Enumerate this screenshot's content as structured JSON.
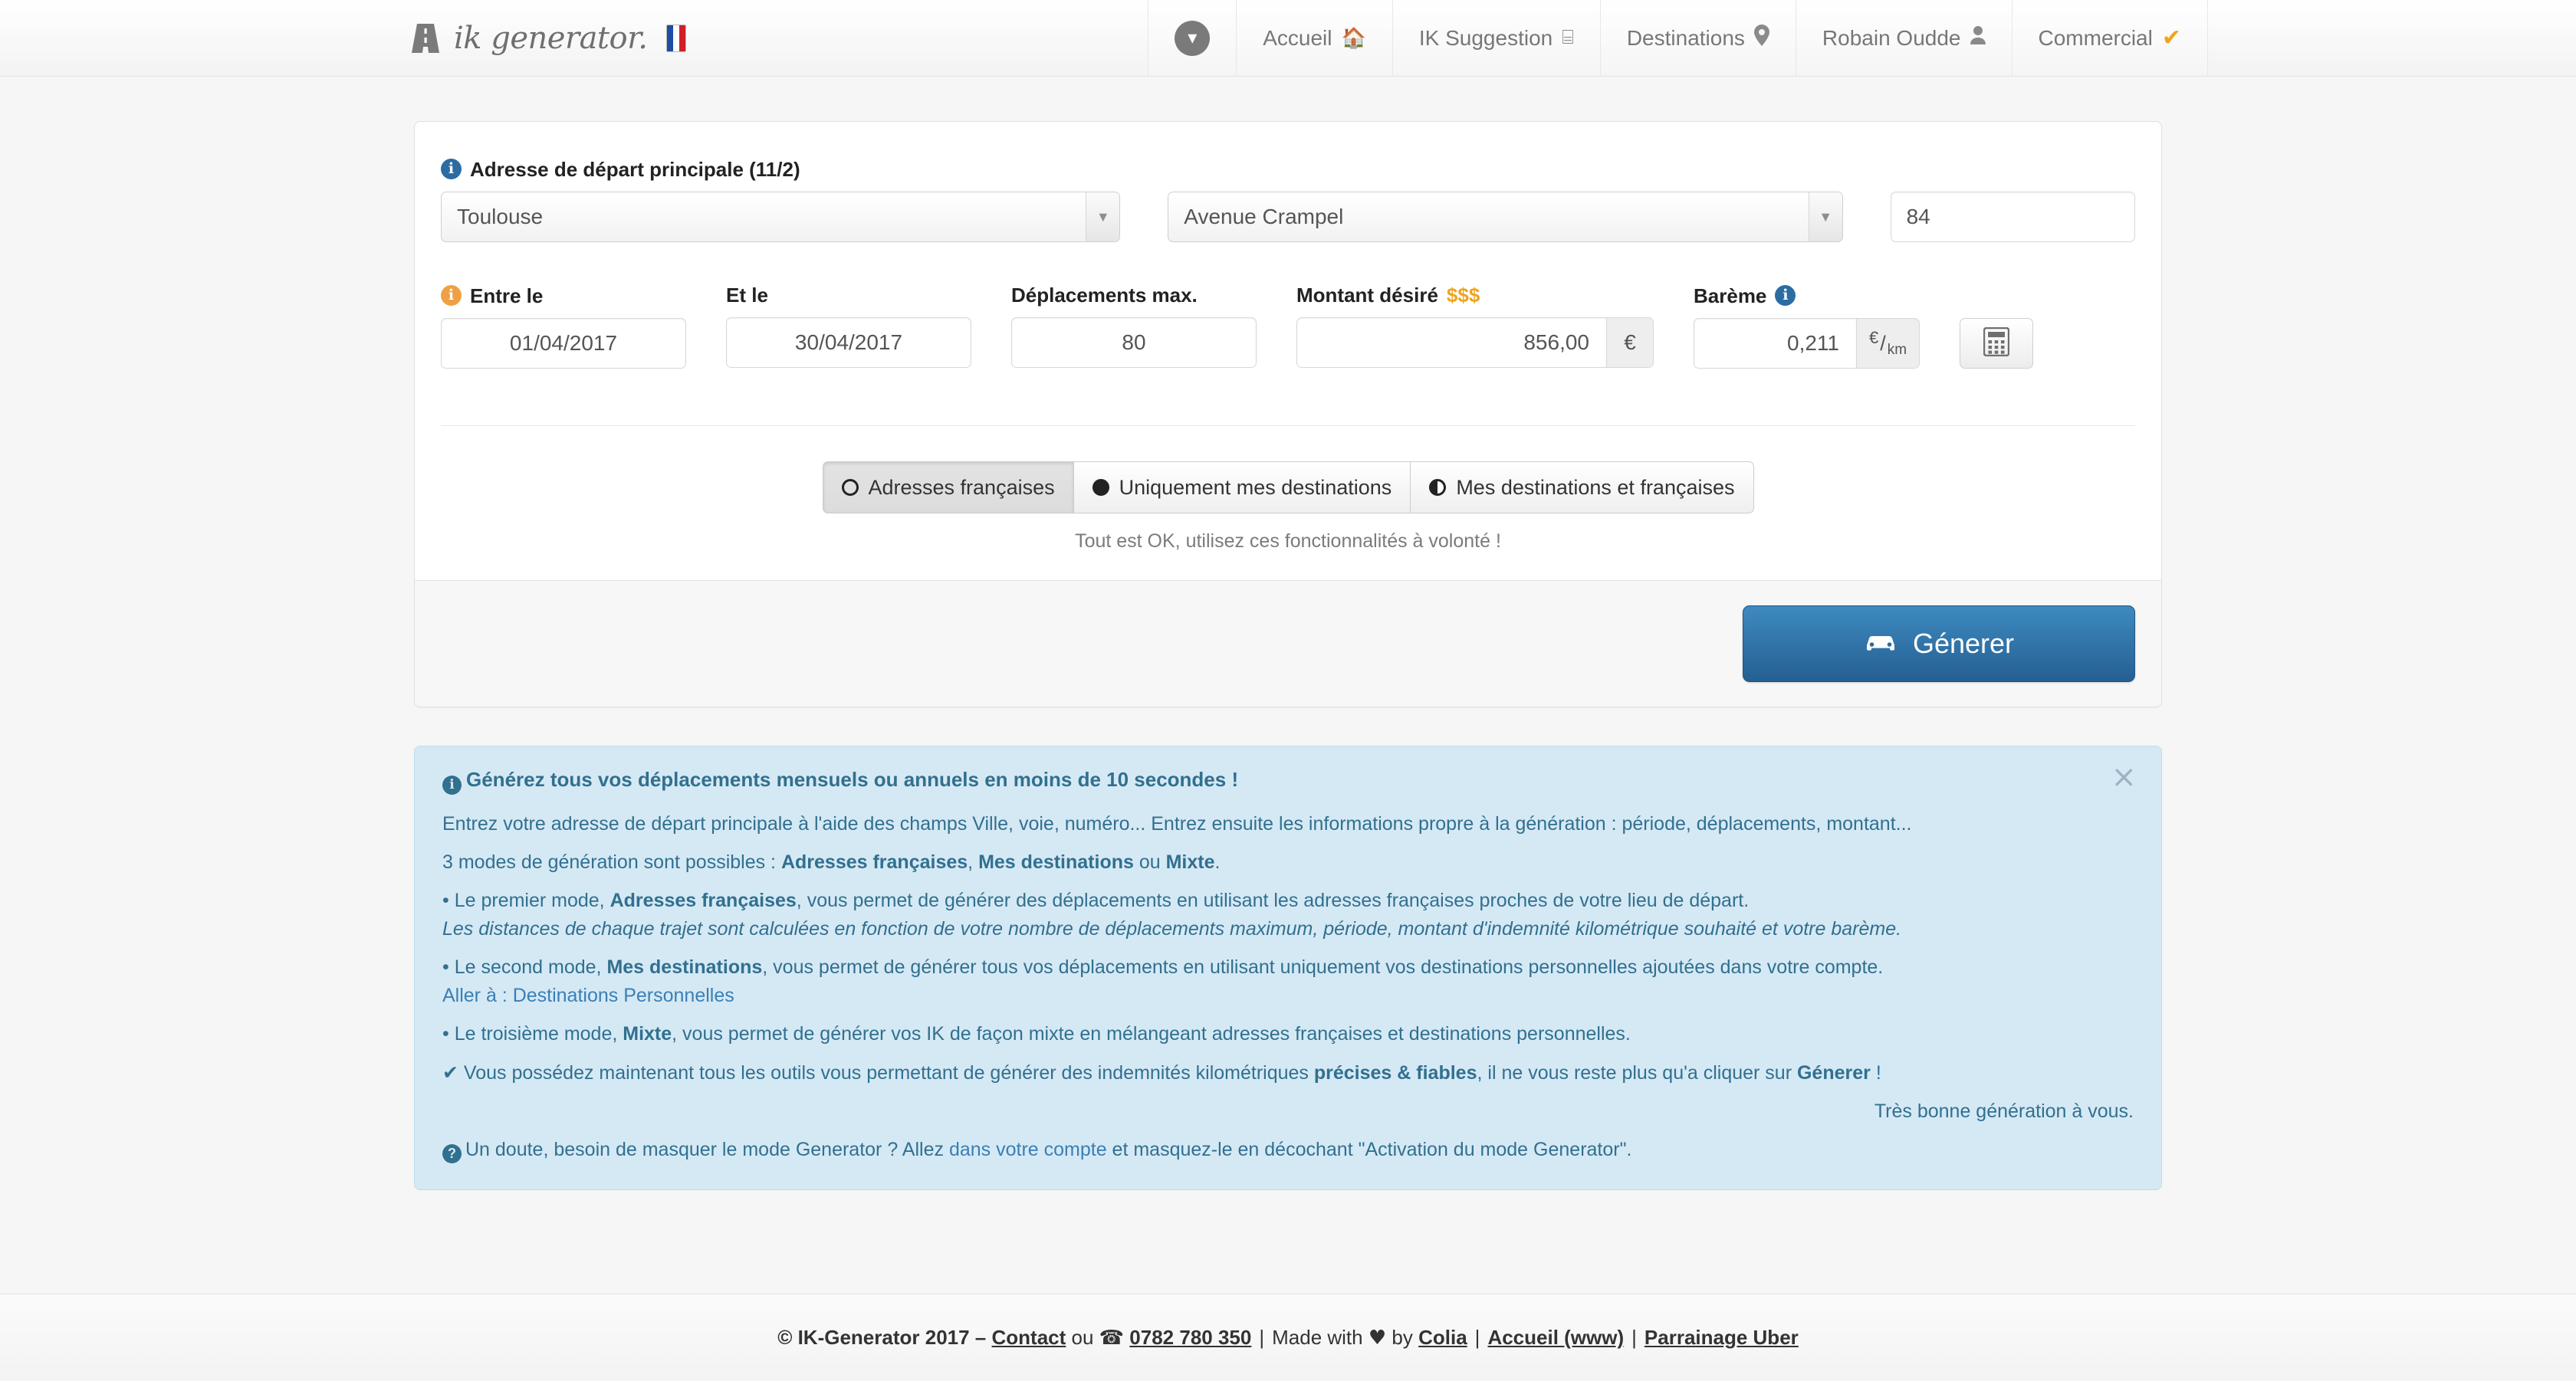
{
  "navbar": {
    "brand": {
      "text": "ik generator.",
      "flag_alt": "french-flag"
    },
    "caret_label": "▾",
    "items": [
      {
        "label": "Accueil",
        "icon": "🏠"
      },
      {
        "label": "IK Suggestion",
        "icon": "⌸"
      },
      {
        "label": "Destinations",
        "icon": "⊙"
      },
      {
        "label": "Robain Oudde",
        "icon": "☗"
      },
      {
        "label": "Commercial",
        "icon": "✔"
      }
    ]
  },
  "form": {
    "address_label": "Adresse de départ principale (11/2)",
    "city": {
      "value": "Toulouse"
    },
    "street": {
      "value": "Avenue Crampel"
    },
    "number": {
      "value": "84"
    },
    "date_from": {
      "label": "Entre le",
      "value": "01/04/2017"
    },
    "date_to": {
      "label": "Et le",
      "value": "30/04/2017"
    },
    "trips_max": {
      "label": "Déplacements max.",
      "value": "80"
    },
    "amount": {
      "label": "Montant désiré",
      "suffix_icon": "$$$",
      "value": "856,00",
      "addon": "€"
    },
    "scale": {
      "label": "Barème",
      "value": "0,211",
      "addon_num": "€",
      "addon_slash": "/",
      "addon_den": "km"
    },
    "calc_button": {
      "icon": "calculator"
    },
    "modes": [
      {
        "label": "Adresses françaises",
        "icon": "circle-empty",
        "active": true
      },
      {
        "label": "Uniquement mes destinations",
        "icon": "circle-full",
        "active": false
      },
      {
        "label": "Mes destinations et françaises",
        "icon": "circle-half",
        "active": false
      }
    ],
    "status_message": "Tout est OK, utilisez ces fonctionnalités à volonté !",
    "generate_button": "Génerer"
  },
  "alert": {
    "close": "×",
    "title": "Générez tous vos déplacements mensuels ou annuels en moins de 10 secondes !",
    "line_intro": "Entrez votre adresse de départ principale à l'aide des champs Ville, voie, numéro... Entrez ensuite les informations propre à la génération : période, déplacements, montant...",
    "modes_prefix": "3 modes de génération sont possibles : ",
    "modes_b1": "Adresses françaises",
    "modes_sep1": ", ",
    "modes_b2": "Mes destinations",
    "modes_sep2": " ou ",
    "modes_b3": "Mixte",
    "modes_suffix": ".",
    "m1_pre": "• Le premier mode, ",
    "m1_b": "Adresses françaises",
    "m1_post": ", vous permet de générer des déplacements en utilisant les adresses françaises proches de votre lieu de départ.",
    "m1_italic": "Les distances de chaque trajet sont calculées en fonction de votre nombre de déplacements maximum, période, montant d'indemnité kilométrique souhaité et votre barème.",
    "m2_pre": "• Le second mode, ",
    "m2_b": "Mes destinations",
    "m2_post": ", vous permet de générer tous vos déplacements en utilisant uniquement vos destinations personnelles ajoutées dans votre compte.",
    "m2_link": "Aller à : Destinations Personnelles",
    "m3_pre": "• Le troisième mode, ",
    "m3_b": "Mixte",
    "m3_post": ", vous permet de générer vos IK de façon mixte en mélangeant adresses françaises et destinations personnelles.",
    "ok_pre": "Vous possédez maintenant tous les outils vous permettant de générer des indemnités kilométriques ",
    "ok_b": "précises & fiables",
    "ok_mid": ", il ne vous reste plus qu'a cliquer sur ",
    "ok_b2": "Génerer",
    "ok_post": " !",
    "closing": "Très bonne génération à vous.",
    "help_pre": "Un doute, besoin de masquer le mode Generator ? Allez ",
    "help_link": "dans votre compte",
    "help_post": " et masquez-le en décochant \"Activation du mode Generator\"."
  },
  "footer": {
    "copyright": "© IK-Generator 2017 –",
    "contact": "Contact",
    "ou": "ou",
    "phone_icon": "☎",
    "phone": "0782 780 350",
    "made_with": "Made with",
    "heart": "♥",
    "by": "by",
    "author": "Colia",
    "home": "Accueil (www)",
    "uber": "Parrainage Uber"
  },
  "colors": {
    "accent": "#2b6ca3",
    "alert_bg": "#d5e9f5",
    "alert_text": "#31708f",
    "orange": "#efa31d"
  }
}
